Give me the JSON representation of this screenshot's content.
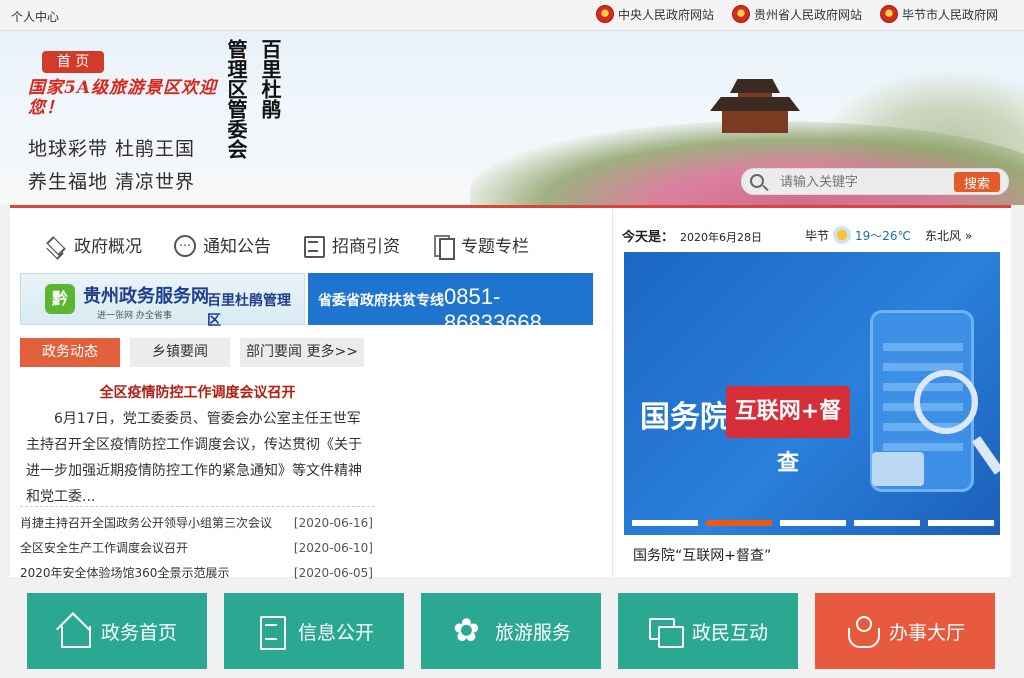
{
  "topbar": {
    "personal": "个人中心",
    "links": [
      "中央人民政府网站",
      "贵州省人民政府网站",
      "毕节市人民政府网"
    ]
  },
  "header": {
    "home_tab": "首 页",
    "red_slogan": "国家5A级旅游景区欢迎您！",
    "slogan_line1": "地球彩带  杜鹃王国",
    "slogan_line2": "养生福地  清凉世界",
    "title_col1": "百里杜鹃",
    "title_col2": "管理区管委会",
    "search_placeholder": "请输入关键字",
    "search_button": "搜索"
  },
  "nav": {
    "tabs": [
      "政府概况",
      "通知公告",
      "招商引资",
      "专题专栏"
    ]
  },
  "banners": {
    "gz_logo": "黔",
    "gz_title": "贵州政务服务网",
    "gz_sub": "进一张网  办全省事",
    "gz_right": "百里杜鹃管理区",
    "hot_label": "省委省政府扶贫专线",
    "hot_number": "0851-86833668"
  },
  "news": {
    "tabs": [
      "政务动态",
      "乡镇要闻",
      "部门要闻 更多>>"
    ],
    "headline": "全区疫情防控工作调度会议召开",
    "summary": "6月17日，党工委委员、管委会办公室主任王世军主持召开全区疫情防控工作调度会议，传达贯彻《关于进一步加强近期疫情防控工作的紧急通知》等文件精神和党工委...",
    "items": [
      {
        "title": "肖捷主持召开全国政务公开领导小组第三次会议",
        "date": "[2020-06-16]"
      },
      {
        "title": "全区安全生产工作调度会议召开",
        "date": "[2020-06-10]"
      },
      {
        "title": "2020年安全体验场馆360全景示范展示",
        "date": "[2020-06-05]"
      }
    ]
  },
  "sidebar": {
    "today_label": "今天是：",
    "today_date": "2020年6月28日",
    "city": "毕节",
    "temp": "19～26℃",
    "wind": "东北风 »",
    "slide_text_left": "国务院",
    "slide_text_box": "互联网+督查",
    "caption": "国务院“互联网+督查”",
    "active_dot": 1
  },
  "tiles": [
    "政务首页",
    "信息公开",
    "旅游服务",
    "政民互动",
    "办事大厅"
  ]
}
